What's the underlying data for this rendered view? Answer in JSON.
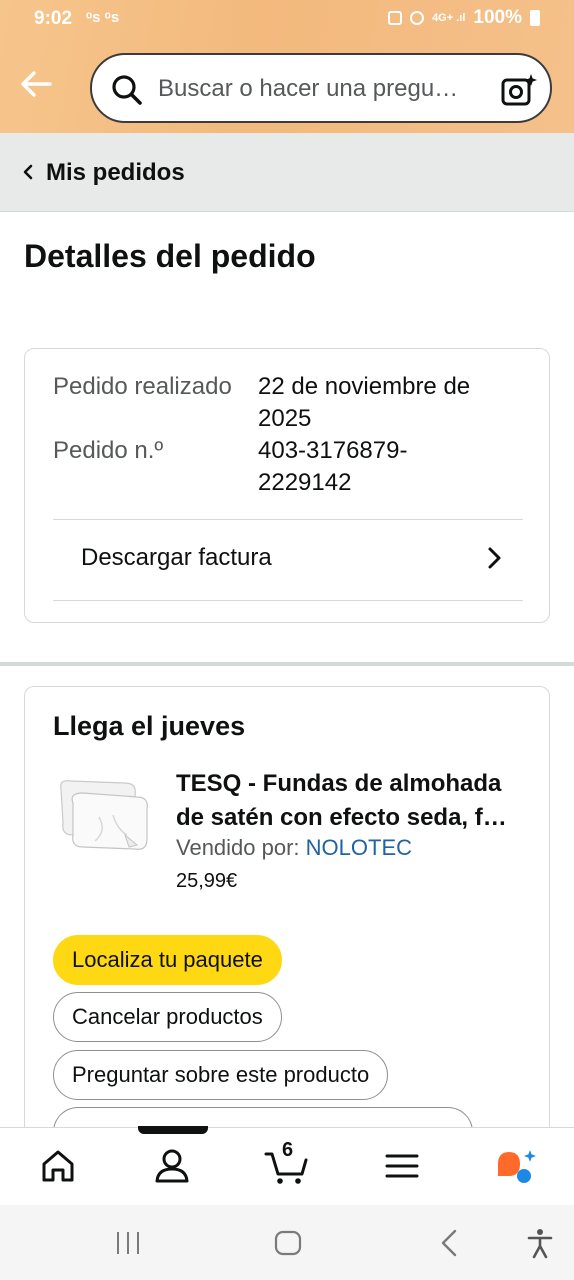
{
  "status": {
    "time": "9:02",
    "carrier_icons": "ᵒs ᵒs",
    "battery": "100%"
  },
  "header": {
    "search_placeholder": "Buscar o hacer una pregu…"
  },
  "breadcrumb": {
    "label": "Mis pedidos"
  },
  "page": {
    "title": "Detalles del pedido"
  },
  "order": {
    "placed_label": "Pedido realizado",
    "placed_value": "22 de noviembre de 2025",
    "number_label": "Pedido n.º",
    "number_value": "403-3176879-2229142",
    "download_label": "Descargar factura"
  },
  "shipment": {
    "arrival": "Llega el jueves",
    "product_title": "TESQ - Fundas de almohada de satén con efecto seda, f…",
    "seller_prefix": "Vendido por: ",
    "seller_name": "NOLOTEC",
    "price": "25,99€",
    "actions": {
      "track": "Localiza tu paquete",
      "cancel": "Cancelar productos",
      "ask": "Preguntar sobre este producto"
    }
  },
  "bottom_nav": {
    "cart_count": "6",
    "items": [
      "home-icon",
      "account-icon",
      "cart-icon",
      "menu-icon",
      "rufus-icon"
    ]
  },
  "colors": {
    "header_orange": "#f3b97d",
    "primary_button": "#ffd814",
    "link": "#2162a1",
    "rufus_orange": "#ff6a2b",
    "rufus_blue": "#1e88e5"
  }
}
